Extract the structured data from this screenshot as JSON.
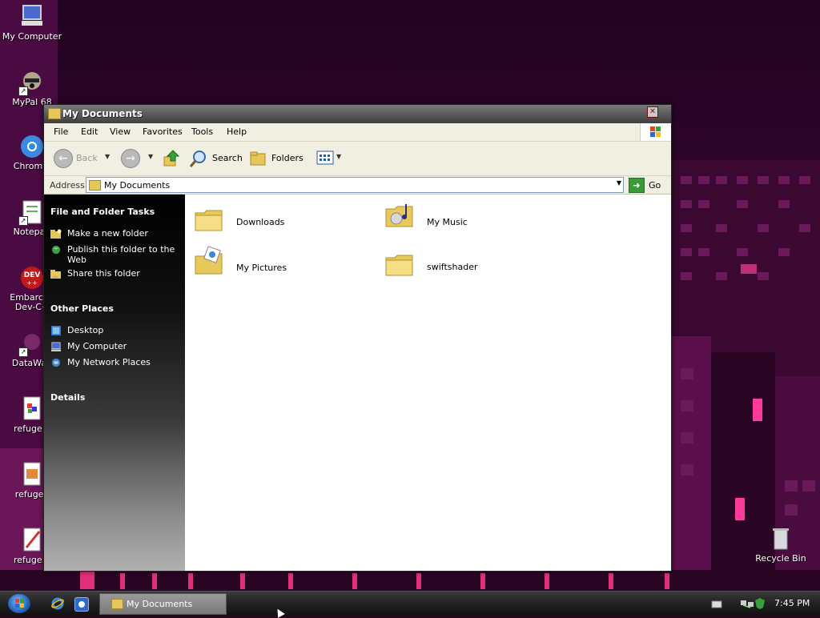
{
  "desktop": {
    "icons": [
      {
        "label": "My Computer"
      },
      {
        "label": "MyPal 68"
      },
      {
        "label": "Chromiu"
      },
      {
        "label": "Notepad"
      },
      {
        "label": "Embarcad",
        "label2": "Dev-C+"
      },
      {
        "label": "DataWag"
      },
      {
        "label": "refuge.P"
      },
      {
        "label": "refuge.J"
      },
      {
        "label": "refuge.b"
      },
      {
        "label": "Recycle Bin"
      }
    ]
  },
  "window": {
    "title": "My Documents",
    "close_glyph": "✕",
    "menu": [
      "File",
      "Edit",
      "View",
      "Favorites",
      "Tools",
      "Help"
    ],
    "toolbar": {
      "back": "Back",
      "search": "Search",
      "folders": "Folders"
    },
    "address": {
      "label": "Address",
      "value": "My Documents",
      "go": "Go"
    },
    "taskpane": {
      "file_folder_tasks": {
        "heading": "File and Folder Tasks",
        "items": [
          "Make a new folder",
          "Publish this folder to the Web",
          "Share this folder"
        ]
      },
      "other_places": {
        "heading": "Other Places",
        "items": [
          "Desktop",
          "My Computer",
          "My Network Places"
        ]
      },
      "details": {
        "heading": "Details"
      }
    },
    "items": [
      {
        "name": "Downloads",
        "icon": "folder-icon"
      },
      {
        "name": "My Music",
        "icon": "music-folder-icon"
      },
      {
        "name": "My Pictures",
        "icon": "pictures-folder-icon"
      },
      {
        "name": "swiftshader",
        "icon": "folder-icon"
      }
    ]
  },
  "taskbar": {
    "active_window": "My Documents",
    "clock": "7:45 PM"
  }
}
